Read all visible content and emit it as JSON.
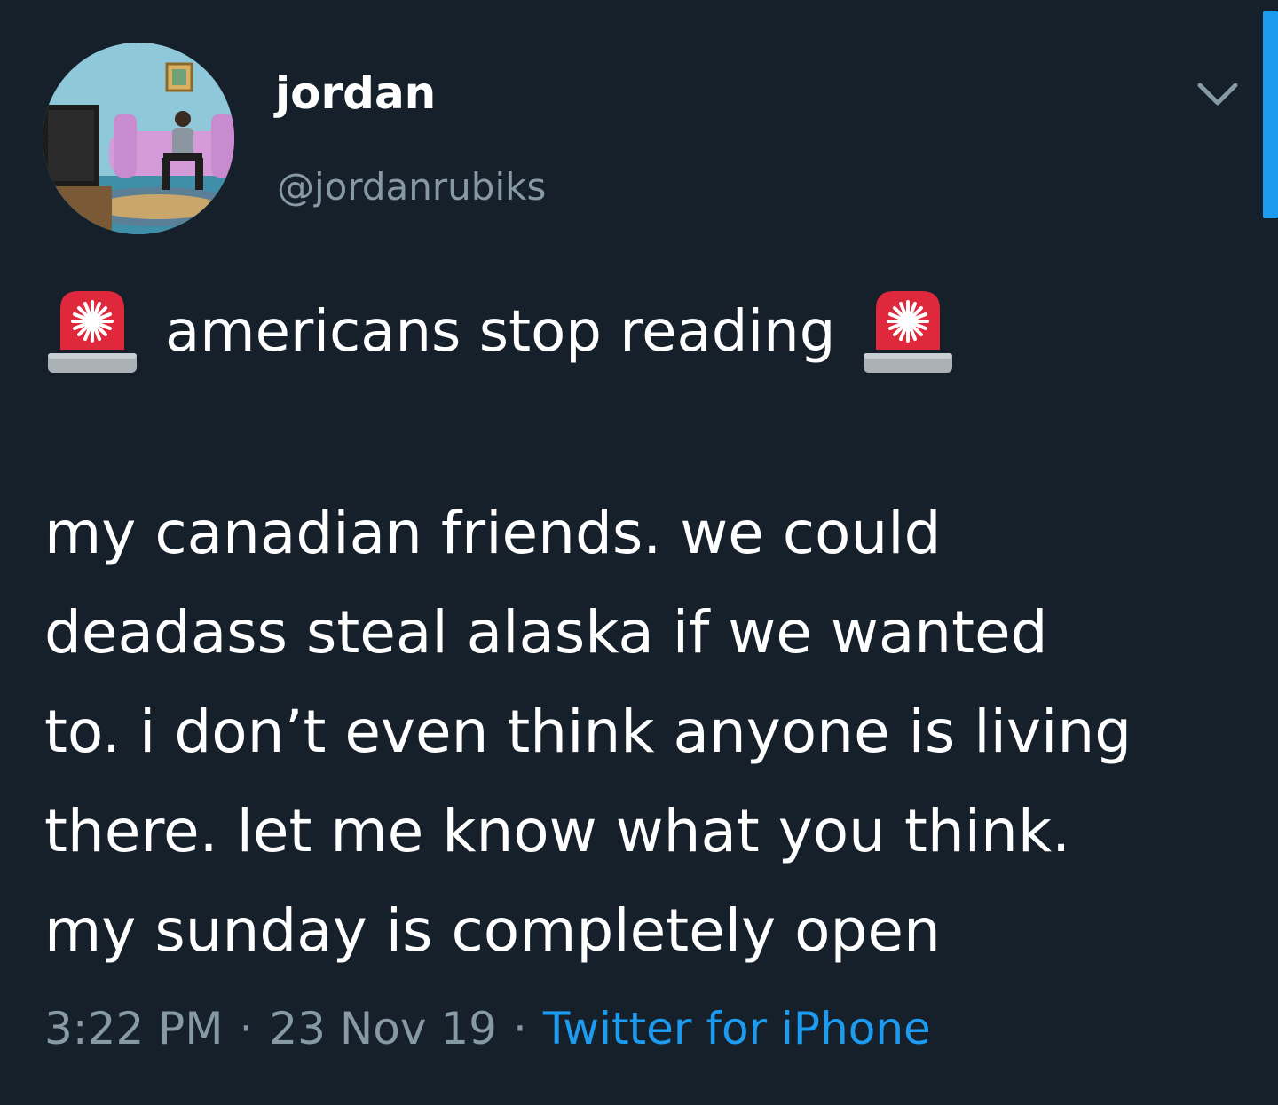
{
  "author": {
    "display_name": "jordan",
    "handle": "@jordanrubiks",
    "avatar": "cartoon-living-room-avatar"
  },
  "tweet": {
    "headline": "americans stop reading",
    "headline_icons": [
      "police-car-light-emoji",
      "police-car-light-emoji"
    ],
    "body_lines": [
      "my canadian friends. we could",
      "deadass steal alaska if we wanted",
      "to. i don’t even think anyone is living",
      "there. let me know what you think.",
      "my sunday is completely open"
    ],
    "time": "3:22 PM",
    "date": "23 Nov 19",
    "separator": "·",
    "source": "Twitter for iPhone"
  },
  "header": {
    "menu_icon": "chevron-down-icon"
  },
  "colors": {
    "background": "#15202b",
    "text": "#ffffff",
    "secondary_text": "#8899a6",
    "link": "#1d9bf0"
  }
}
